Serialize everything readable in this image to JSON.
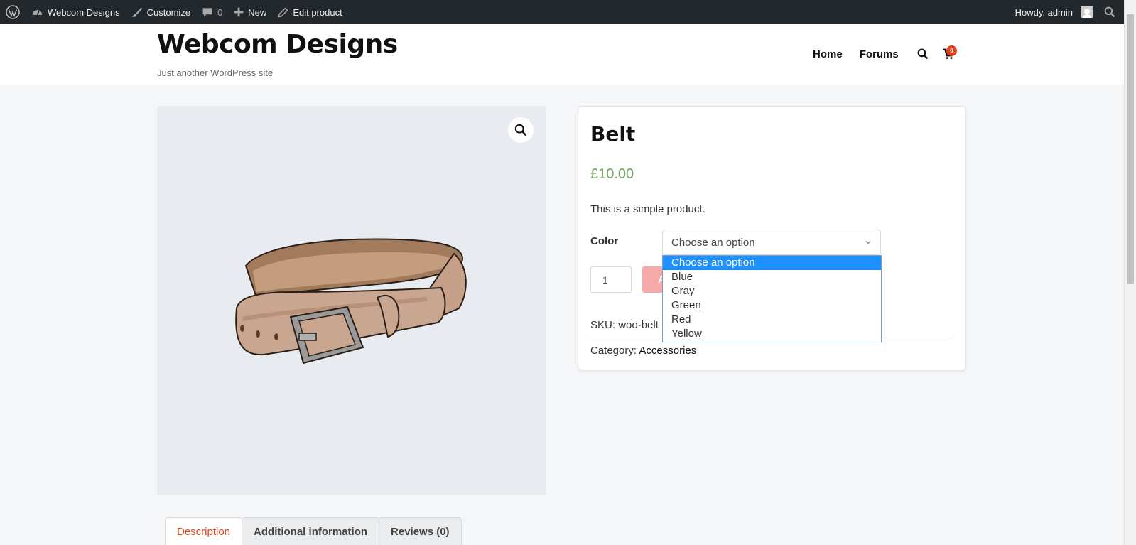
{
  "adminbar": {
    "site_name": "Webcom Designs",
    "customize": "Customize",
    "comments_count": "0",
    "new": "New",
    "edit_product": "Edit product",
    "howdy": "Howdy, admin"
  },
  "header": {
    "site_title": "Webcom Designs",
    "tagline": "Just another WordPress site",
    "nav": [
      "Home",
      "Forums"
    ],
    "cart_count": "0"
  },
  "product": {
    "title": "Belt",
    "price": "£10.00",
    "short_description": "This is a simple product.",
    "color_label": "Color",
    "select_value": "Choose an option",
    "options": [
      "Choose an option",
      "Blue",
      "Gray",
      "Green",
      "Red",
      "Yellow"
    ],
    "quantity": "1",
    "add_button_initial": "A",
    "sku_label": "SKU:",
    "sku_value": "woo-belt",
    "category_label": "Category:",
    "category_value": "Accessories"
  },
  "tabs": [
    "Description",
    "Additional information",
    "Reviews (0)"
  ],
  "colors": {
    "adminbar_bg": "#23282d",
    "price": "#77a464",
    "accent": "#e2401c",
    "dropdown_highlight": "#1e90ff"
  }
}
